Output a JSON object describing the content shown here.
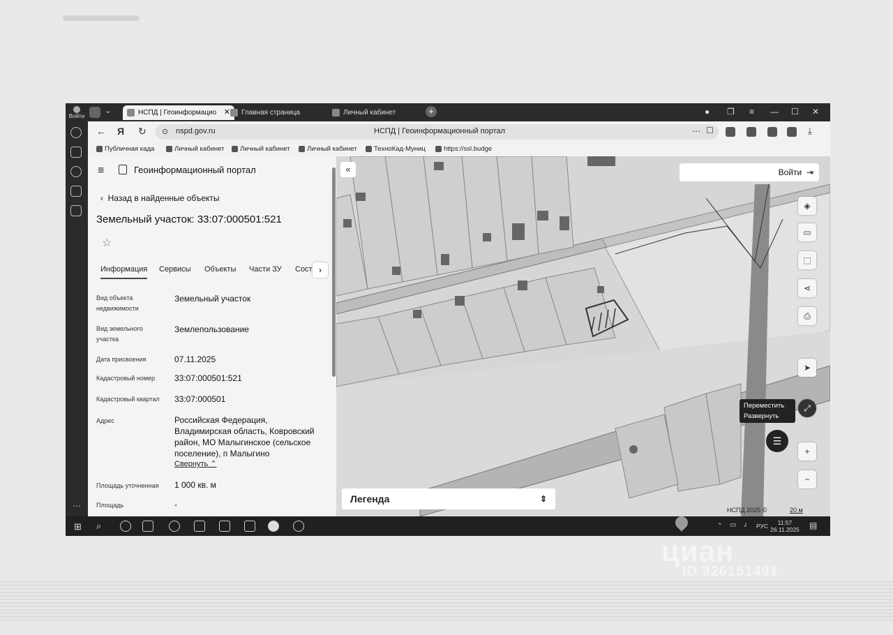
{
  "browser": {
    "tabs": [
      {
        "label": "НСПД | Геоинформацио",
        "active": true
      },
      {
        "label": "Главная страница",
        "active": false
      },
      {
        "label": "Личный кабинет",
        "active": false
      }
    ],
    "url": "nspd.gov.ru",
    "page_title": "НСПД | Геоинформационный портал",
    "login_avatar_label": "Войти",
    "bookmarks": [
      "Публичная када",
      "Личный кабинет",
      "Личный кабинет",
      "Личный кабинет",
      "ТехноКад-Муниц",
      "https://ssl.budge"
    ]
  },
  "panel": {
    "portal_title": "Геоинформационный портал",
    "back_label": "Назад в найденные объекты",
    "object_title": "Земельный участок: 33:07:000501:521",
    "tabs": [
      "Информация",
      "Сервисы",
      "Объекты",
      "Части ЗУ",
      "Соста"
    ],
    "fields": [
      {
        "label": "Вид объекта недвижимости",
        "value": "Земельный участок"
      },
      {
        "label": "Вид земельного участка",
        "value": "Землепользование"
      },
      {
        "label": "Дата присвоения",
        "value": "07.11.2025"
      },
      {
        "label": "Кадастровый номер",
        "value": "33:07:000501:521"
      },
      {
        "label": "Кадастровый квартал",
        "value": "33:07:000501"
      },
      {
        "label": "Адрес",
        "value": "Российская Федерация, Владимирская область, Ковровский район, МО Малыгинское (сельское поселение), п Малыгино"
      },
      {
        "label": "Площадь уточненная",
        "value": "1 000 кв. м"
      },
      {
        "label": "Площадь",
        "value": "-"
      }
    ],
    "collapse_label": "Свернуть"
  },
  "map": {
    "login_label": "Войти",
    "tooltip_lines": [
      "Переместить",
      "Развернуть"
    ],
    "legend_label": "Легенда",
    "copyright": "НСПД 2025 ©",
    "scale": "20 м",
    "plus": "+",
    "minus": "−"
  },
  "taskbar": {
    "language": "РУС",
    "time": "11:57",
    "date": "26.11.2025"
  },
  "watermark": {
    "brand": "циан",
    "id": "ID 326151491"
  }
}
